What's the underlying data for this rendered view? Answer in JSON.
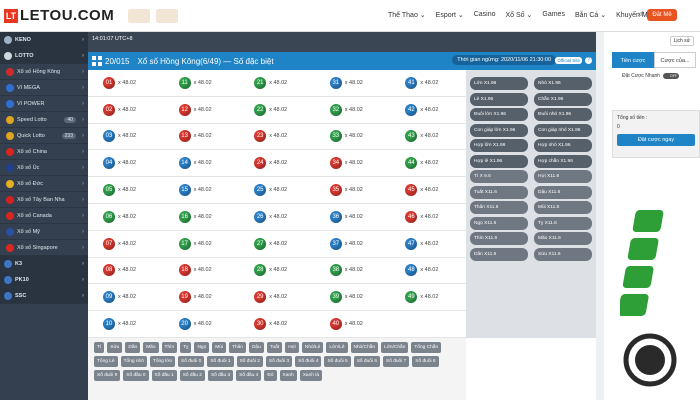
{
  "brand": {
    "logo_box": "LT",
    "logo_text": "LETOU.COM"
  },
  "nav": [
    "Thể Thao ⌄",
    "Esport ⌄",
    "Casino",
    "Xổ Số ⌄",
    "Games",
    "Bắn Cá ⌄",
    "Khuyến Mãi ⌄"
  ],
  "login": {
    "code": "x0",
    "btn": "Đăt Mê"
  },
  "server_time": "14:01:07 UTC+8",
  "sidebar": [
    {
      "label": "KENO",
      "color": "#9fb3c8",
      "head": true
    },
    {
      "label": "LOTTO",
      "color": "#cfd7df",
      "head": true
    },
    {
      "label": "Xổ số Hồng Kông",
      "color": "#d02b2b"
    },
    {
      "label": "Vì MEGA",
      "color": "#2f6fd1"
    },
    {
      "label": "Vì POWER",
      "color": "#2f6fd1"
    },
    {
      "label": "Speed Lotto",
      "color": "#e0a322",
      "count": "40"
    },
    {
      "label": "Quick Lotto",
      "color": "#e0a322",
      "count": "233"
    },
    {
      "label": "Xổ số China",
      "color": "#d6261e"
    },
    {
      "label": "Xổ số Úc",
      "color": "#23408e"
    },
    {
      "label": "Xổ số Đức",
      "color": "#e3b21e"
    },
    {
      "label": "Xổ số Tây Ban Nha",
      "color": "#d2231f"
    },
    {
      "label": "Xổ số Canada",
      "color": "#d8261f"
    },
    {
      "label": "Xổ số Mỹ",
      "color": "#2a4fa3"
    },
    {
      "label": "Xổ số Singapore",
      "color": "#d9281f"
    },
    {
      "label": "K3",
      "color": "#3a77c4",
      "head": true
    },
    {
      "label": "PK10",
      "color": "#3a77c4",
      "head": true
    },
    {
      "label": "SSC",
      "color": "#3a77c4",
      "head": true
    }
  ],
  "panel": {
    "draw": "20/015",
    "title": "Xổ số Hồng Kông(6/49) — Số đặc biệt",
    "close_time": "Thời gian ngừng: 2020/11/06 21:30:00",
    "official": "Official Site",
    "help": "?"
  },
  "balls": [
    [
      "01",
      "11",
      "21",
      "31",
      "41"
    ],
    [
      "02",
      "12",
      "22",
      "32",
      "42"
    ],
    [
      "03",
      "13",
      "23",
      "33",
      "43"
    ],
    [
      "04",
      "14",
      "24",
      "34",
      "44"
    ],
    [
      "05",
      "15",
      "25",
      "35",
      "45"
    ],
    [
      "06",
      "16",
      "26",
      "36",
      "46"
    ],
    [
      "07",
      "17",
      "27",
      "37",
      "47"
    ],
    [
      "08",
      "18",
      "28",
      "38",
      "48"
    ],
    [
      "09",
      "19",
      "29",
      "39",
      "49"
    ],
    [
      "10",
      "20",
      "30",
      "40",
      ""
    ]
  ],
  "ball_colors": {
    "01": "#d9372e",
    "11": "#2fa04a",
    "21": "#2fa04a",
    "31": "#2a7fc7",
    "41": "#2a7fc7",
    "02": "#d9372e",
    "12": "#d9372e",
    "22": "#2fa04a",
    "32": "#2fa04a",
    "42": "#2a7fc7",
    "03": "#2a7fc7",
    "13": "#d9372e",
    "23": "#d9372e",
    "33": "#2fa04a",
    "43": "#2fa04a",
    "04": "#2a7fc7",
    "14": "#2a7fc7",
    "24": "#d9372e",
    "34": "#d9372e",
    "44": "#2fa04a",
    "05": "#2fa04a",
    "15": "#2a7fc7",
    "25": "#2a7fc7",
    "35": "#d9372e",
    "45": "#d9372e",
    "06": "#2fa04a",
    "16": "#2fa04a",
    "26": "#2a7fc7",
    "36": "#2a7fc7",
    "46": "#d9372e",
    "07": "#d9372e",
    "17": "#2fa04a",
    "27": "#2fa04a",
    "37": "#2a7fc7",
    "47": "#2a7fc7",
    "08": "#d9372e",
    "18": "#d9372e",
    "28": "#2fa04a",
    "38": "#2fa04a",
    "48": "#2a7fc7",
    "09": "#2a7fc7",
    "19": "#d9372e",
    "29": "#d9372e",
    "39": "#2fa04a",
    "49": "#2fa04a",
    "10": "#2a7fc7",
    "20": "#2a7fc7",
    "30": "#d9372e",
    "40": "#d9372e"
  },
  "odds": "x 48.02",
  "right_bets": [
    [
      "Lớn  X1.96",
      "Nhỏ  X1.96"
    ],
    [
      "Lẻ  X1.96",
      "Chẵn  X1.96"
    ],
    [
      "Đuôi lớn  X1.96",
      "Đuôi nhỏ  X1.96"
    ],
    [
      "Con giáp lớn  X1.96",
      "Con giáp nhỏ  X1.96"
    ],
    [
      "Hợp lớn  X1.96",
      "Hợp nhỏ  X1.96"
    ],
    [
      "Hợp lẻ  X1.96",
      "Hợp chẵn  X1.96"
    ],
    [
      "Tí  X 9.5",
      "Hợi  X11.6"
    ],
    [
      "Tuất  X11.6",
      "Dậu  X11.6"
    ],
    [
      "Thân  X11.6",
      "Mùi  X11.6"
    ],
    [
      "Ngọ  X11.6",
      "Tỵ  X11.6"
    ],
    [
      "Thìn  X11.6",
      "Mão  X11.6"
    ],
    [
      "Dần  X11.6",
      "Sửu  X11.6"
    ]
  ],
  "chips": [
    "Tí",
    "Sửu",
    "Dần",
    "Mão",
    "Thìn",
    "Tỵ",
    "Ngọ",
    "Mùi",
    "Thân",
    "Dậu",
    "Tuất",
    "Hợi",
    "Nhỏ/Lẻ",
    "Lớn/Lẻ",
    "Nhỏ/Chẵn",
    "Lớn/Chẵn",
    "Tổng Chẵn",
    "Tổng Lẻ",
    "Tổng nhỏ",
    "Tổng lớn",
    "Số đuôi 0",
    "Số đuôi 1",
    "Số đuôi 2",
    "Số đuôi 3",
    "Số đuôi 4",
    "Số đuôi 5",
    "Số đuôi 6",
    "Số đuôi 7",
    "Số đuôi 8",
    "Số đuôi 9",
    "Số đầu 0",
    "Số đầu 1",
    "Số đầu 2",
    "Số đầu 3",
    "Số đầu 4",
    "Đỏ",
    "Xanh",
    "Xanh lá"
  ],
  "bet_panel": {
    "history": "Lịch sử",
    "tab1": "Tiền cược",
    "tab2": "Cược của...",
    "quick": "Đặt Cược Nhanh",
    "toggle": "OFF",
    "total_label": "Tổng số tiền :",
    "total_value": "0",
    "place": "Đặt cược ngay"
  },
  "colors": {
    "accent": "#1f84c6",
    "sidebar": "#34404f"
  }
}
